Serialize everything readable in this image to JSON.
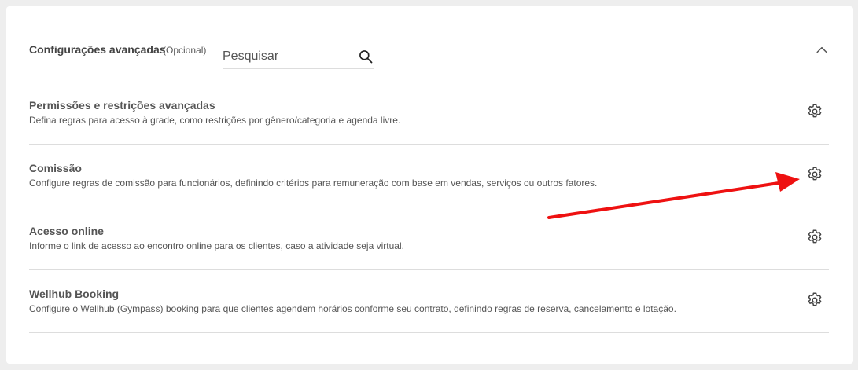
{
  "header": {
    "title": "Configurações avançadas",
    "optional": "(Opcional)",
    "search_placeholder": "Pesquisar"
  },
  "rows": [
    {
      "title": "Permissões e restrições avançadas",
      "description": "Defina regras para acesso à grade, como restrições por gênero/categoria e agenda livre."
    },
    {
      "title": "Comissão",
      "description": "Configure regras de comissão para funcionários, definindo critérios para remuneração com base em vendas, serviços ou outros fatores."
    },
    {
      "title": "Acesso online",
      "description": "Informe o link de acesso ao encontro online para os clientes, caso a atividade seja virtual."
    },
    {
      "title": "Wellhub Booking",
      "description": "Configure o Wellhub (Gympass) booking para que clientes agendem horários conforme seu contrato, definindo regras de reserva, cancelamento e lotação."
    }
  ],
  "icons": {
    "search": "search-icon",
    "collapse": "chevron-up-icon",
    "settings": "gear-icon",
    "annotation": "red-arrow-annotation"
  },
  "colors": {
    "annotation": "#ee1111"
  }
}
